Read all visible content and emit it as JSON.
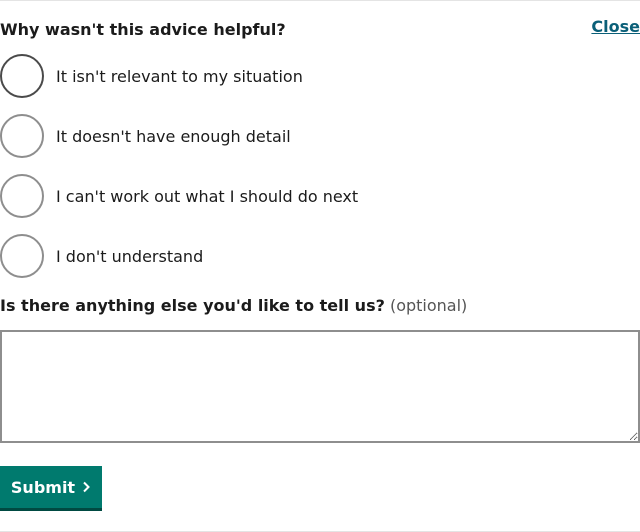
{
  "feedback": {
    "heading": "Why wasn't this advice helpful?",
    "close_label": "Close",
    "options": [
      {
        "label": "It isn't relevant to my situation",
        "selected": false
      },
      {
        "label": "It doesn't have enough detail",
        "selected": false
      },
      {
        "label": "I can't work out what I should do next",
        "selected": false
      },
      {
        "label": "I don't understand",
        "selected": false
      }
    ],
    "question": "Is there anything else you'd like to tell us?",
    "question_optional": "(optional)",
    "comments_value": "",
    "submit_label": "Submit",
    "submit_icon": "chevron-right-icon",
    "colors": {
      "link": "#0a5f78",
      "button": "#007a6e",
      "button_shadow": "#004a42"
    }
  }
}
